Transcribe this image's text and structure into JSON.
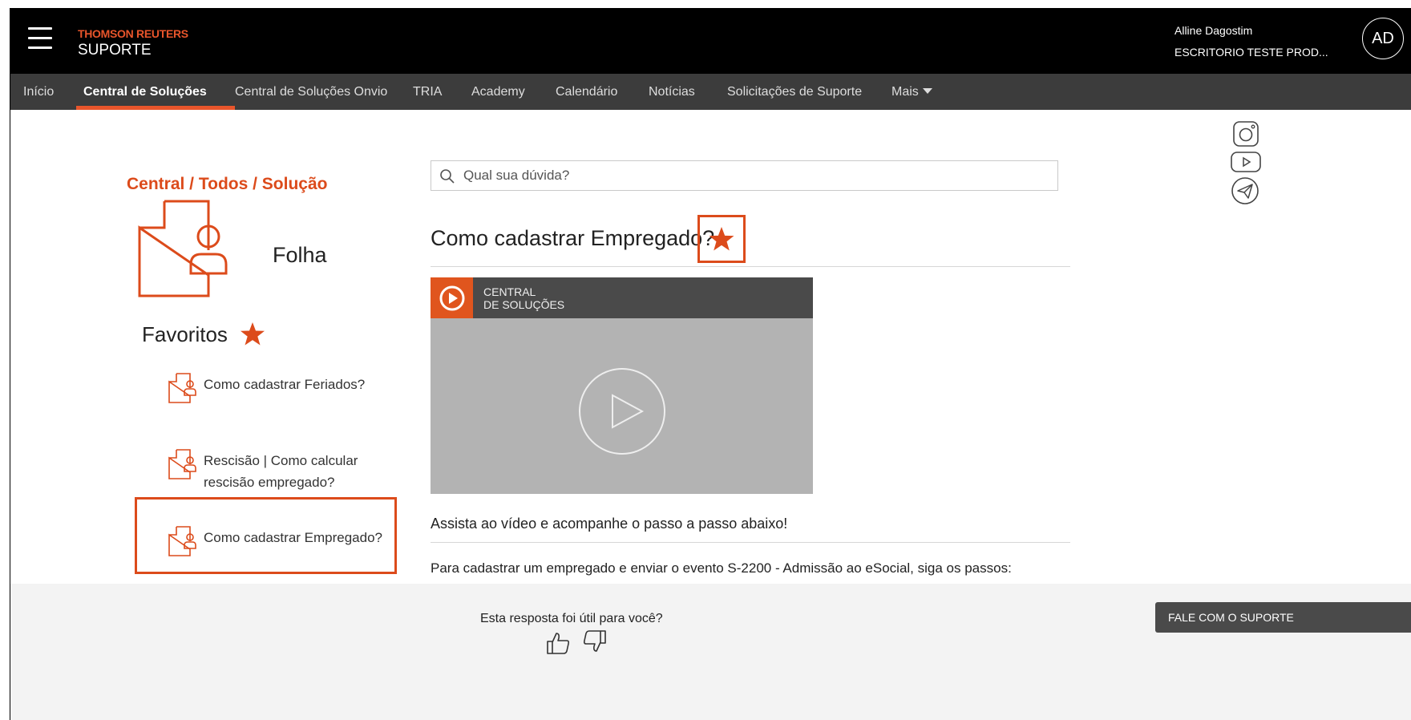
{
  "header": {
    "brand_top": "THOMSON REUTERS",
    "brand_sub": "SUPORTE",
    "user_name": "Alline Dagostim",
    "user_org": "ESCRITORIO TESTE PROD...",
    "avatar_initials": "AD"
  },
  "nav": {
    "items": [
      {
        "label": "Início"
      },
      {
        "label": "Central de Soluções",
        "active": true
      },
      {
        "label": "Central de Soluções Onvio"
      },
      {
        "label": "TRIA"
      },
      {
        "label": "Academy"
      },
      {
        "label": "Calendário"
      },
      {
        "label": "Notícias"
      },
      {
        "label": "Solicitações de Suporte"
      },
      {
        "label": "Mais"
      }
    ]
  },
  "sidebar": {
    "breadcrumb": "Central / Todos / Solução",
    "category": "Folha",
    "favorites_title": "Favoritos",
    "favorites": [
      {
        "label": "Como cadastrar Feriados?"
      },
      {
        "label": "Rescisão | Como calcular rescisão empregado?"
      },
      {
        "label": "Como cadastrar Empregado?"
      }
    ]
  },
  "search": {
    "placeholder": "Qual sua dúvida?"
  },
  "article": {
    "title": "Como cadastrar Empregado?",
    "video_header": "CENTRAL\nDE SOLUÇÕES",
    "watch_text": "Assista ao vídeo e acompanhe o passo a passo abaixo!",
    "intro_text": "Para cadastrar um empregado e enviar o evento S-2200 - Admissão ao eSocial, siga os passos:"
  },
  "footer": {
    "question": "Esta resposta foi útil para você?",
    "support_button": "FALE COM O SUPORTE"
  },
  "icons": {
    "menu": "menu-icon",
    "search": "search-icon",
    "star": "star-icon",
    "document_user": "document-user-icon",
    "play": "play-icon",
    "thumbs_up": "thumbs-up-icon",
    "thumbs_down": "thumbs-down-icon",
    "instagram": "instagram-icon",
    "youtube": "youtube-icon",
    "telegram": "telegram-icon"
  },
  "colors": {
    "accent": "#dc4b1b",
    "header_bg": "#000000",
    "nav_bg": "#3c3c3c",
    "footer_bg": "#f3f3f3"
  }
}
